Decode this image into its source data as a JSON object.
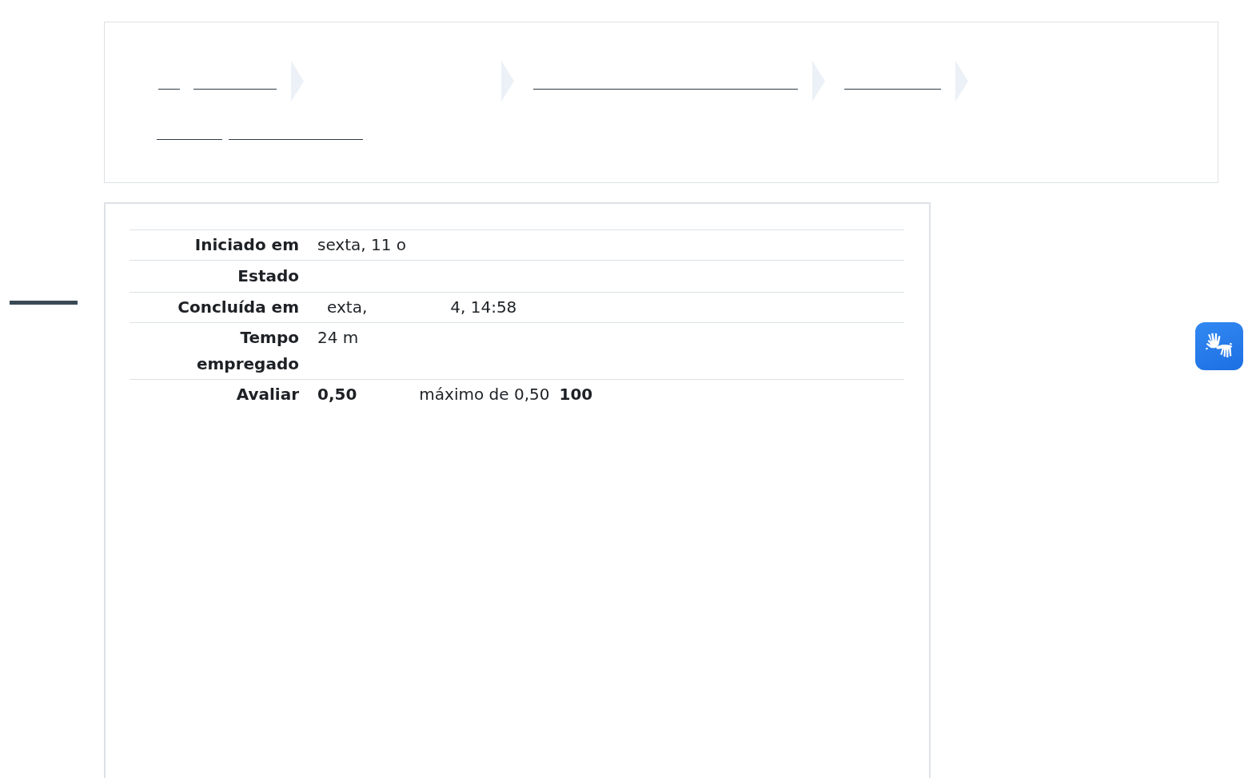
{
  "breadcrumb": {
    "rows": [
      {
        "items": [
          {
            "kind": "link"
          },
          {
            "kind": "link"
          },
          {
            "kind": "separator"
          },
          {
            "kind": "separator"
          },
          {
            "kind": "link"
          },
          {
            "kind": "separator"
          },
          {
            "kind": "link"
          },
          {
            "kind": "separator"
          }
        ]
      },
      {
        "items": [
          {
            "kind": "link"
          },
          {
            "kind": "link"
          }
        ]
      }
    ]
  },
  "summary": {
    "rows": [
      {
        "label": "Iniciado em",
        "parts": [
          {
            "text": "sexta, 11 o",
            "bold": false
          }
        ]
      },
      {
        "label": "Estado"
      },
      {
        "label": "Concluída em",
        "parts": [
          {
            "text": "exta,",
            "bold": false
          },
          {
            "text": "4, 14:58",
            "bold": false
          }
        ]
      },
      {
        "label": "Tempo empregado",
        "parts": [
          {
            "text": "24 m",
            "bold": false
          }
        ]
      },
      {
        "label": "Avaliar",
        "parts": [
          {
            "text": "0,50",
            "bold": true
          },
          {
            "text": "máximo de 0,50",
            "bold": false
          },
          {
            "text": "100",
            "bold": true
          }
        ]
      }
    ]
  }
}
